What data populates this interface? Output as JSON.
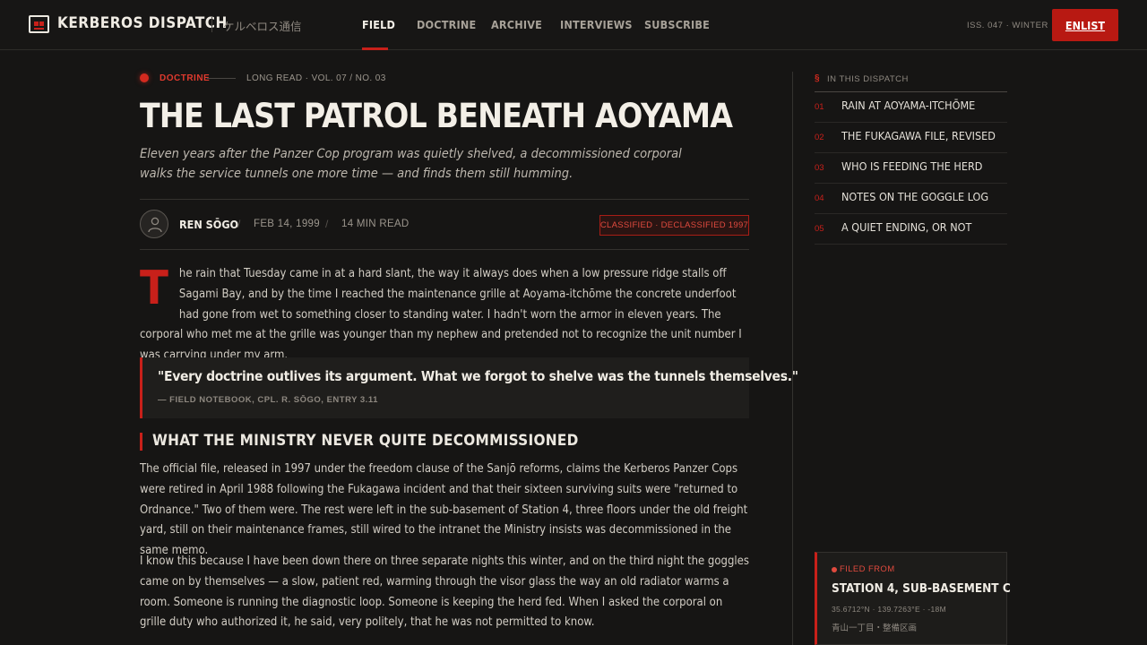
{
  "nav": {
    "brand": "KERBEROS DISPATCH",
    "brand_jp": "ケルベロス通信",
    "items": [
      {
        "label": "FIELD",
        "active": true
      },
      {
        "label": "DOCTRINE"
      },
      {
        "label": "ARCHIVE"
      },
      {
        "label": "INTERVIEWS"
      },
      {
        "label": "SUBSCRIBE"
      }
    ],
    "issue": "ISS. 047 · WINTER",
    "cta": "ENLIST"
  },
  "article": {
    "category": "DOCTRINE",
    "meta": "LONG READ · VOL. 07 / NO. 03",
    "title": "THE LAST PATROL BENEATH AOYAMA",
    "dek": "Eleven years after the Panzer Cop program was quietly shelved, a decommissioned corporal walks the service tunnels one more time — and finds them still humming.",
    "author": "REN SŌGO",
    "date": "FEB 14, 1999",
    "read_time": "14 MIN READ",
    "badge": "CLASSIFIED · DECLASSIFIED 1997",
    "dropcap": "T",
    "para1": "he rain that Tuesday came in at a hard slant, the way it always does when a low pressure ridge stalls off Sagami Bay, and by the time I reached the maintenance grille at Aoyama-itchōme the concrete underfoot had gone from wet to something closer to standing water. I hadn't worn the armor in eleven years. The corporal who met me at the grille was younger than my nephew and pretended not to recognize the unit number I was carrying under my arm.",
    "pullquote": "\"Every doctrine outlives its argument. What we forgot to shelve was the tunnels themselves.\"",
    "pullquote_cite": "— FIELD NOTEBOOK, CPL. R. SŌGO, ENTRY 3.11",
    "subhead": "WHAT THE MINISTRY NEVER QUITE DECOMMISSIONED",
    "para2": "The official file, released in 1997 under the freedom clause of the Sanjō reforms, claims the Kerberos Panzer Cops were retired in April 1988 following the Fukagawa incident and that their sixteen surviving suits were \"returned to Ordnance.\" Two of them were. The rest were left in the sub-basement of Station 4, three floors under the old freight yard, still on their maintenance frames, still wired to the intranet the Ministry insists was decommissioned in the same memo.",
    "para3": "I know this because I have been down there on three separate nights this winter, and on the third night the goggles came on by themselves — a slow, patient red, warming through the visor glass the way an old radiator warms a room. Someone is running the diagnostic loop. Someone is keeping the herd fed. When I asked the corporal on grille duty who authorized it, he said, very politely, that he was not permitted to know."
  },
  "toc": {
    "symbol": "§",
    "heading": "IN THIS DISPATCH",
    "items": [
      {
        "num": "01",
        "label": "RAIN AT AOYAMA-ITCHŌME"
      },
      {
        "num": "02",
        "label": "THE FUKAGAWA FILE, REVISED"
      },
      {
        "num": "03",
        "label": "WHO IS FEEDING THE HERD"
      },
      {
        "num": "04",
        "label": "NOTES ON THE GOGGLE LOG"
      },
      {
        "num": "05",
        "label": "A QUIET ENDING, OR NOT"
      }
    ]
  },
  "filed": {
    "label": "FILED FROM",
    "location": "STATION 4, SUB-BASEMENT C",
    "coords": "35.6712°N · 139.7263°E · -18M",
    "jp": "青山一丁目・整備区画"
  },
  "colors": {
    "accent": "#c8201a",
    "background": "#161514",
    "text": "#d8d4cc"
  }
}
